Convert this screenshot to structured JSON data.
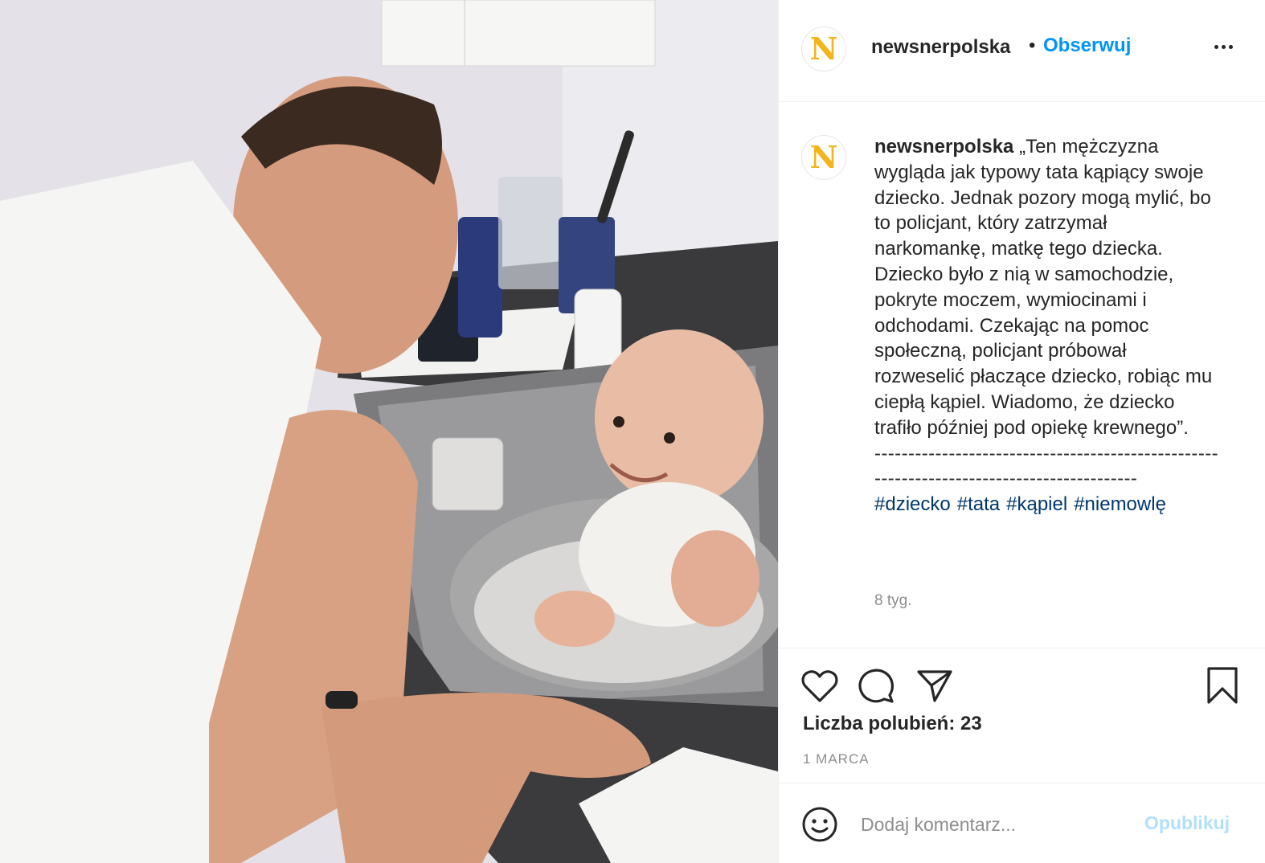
{
  "post": {
    "image_description_icon": "photo",
    "author": "newsnerpolska",
    "avatar_letter": "N",
    "dot": "•",
    "follow_label": "Obserwuj",
    "more_icon": "more-horizontal-icon"
  },
  "caption": {
    "username": "newsnerpolska",
    "text": "„Ten mężczyzna wygląda jak typowy tata kąpiący swoje dziecko. Jednak pozory mogą mylić, bo to policjant, który zatrzymał narkomankę, matkę tego dziecka. Dziecko było z nią w samochodzie, pokryte moczem, wymiocinami i odchodami. Czekając na pomoc społeczną, policjant próbował rozweselić płaczące dziecko, robiąc mu ciepłą kąpiel. Wiadomo, że dziecko trafiło później pod opiekę krewnego”.",
    "separator": "------------------------------------------------------------------------------------------",
    "hashtags": [
      "#dziecko",
      "#tata",
      "#kąpiel",
      "#niemowlę"
    ],
    "time_ago": "8 tyg."
  },
  "actions": {
    "icons": [
      "heart-icon",
      "comment-icon",
      "share-icon",
      "bookmark-icon"
    ],
    "likes_label": "Liczba polubień: 23",
    "date": "1 MARCA"
  },
  "comment": {
    "emoji_icon": "smiley-icon",
    "placeholder": "Dodaj komentarz...",
    "post_label": "Opublikuj"
  },
  "colors": {
    "link": "#0095f6",
    "hashtag": "#00376b",
    "avatar_letter": "#f2b51b",
    "post_disabled": "#b2dffc",
    "muted": "#8e8e8e"
  }
}
